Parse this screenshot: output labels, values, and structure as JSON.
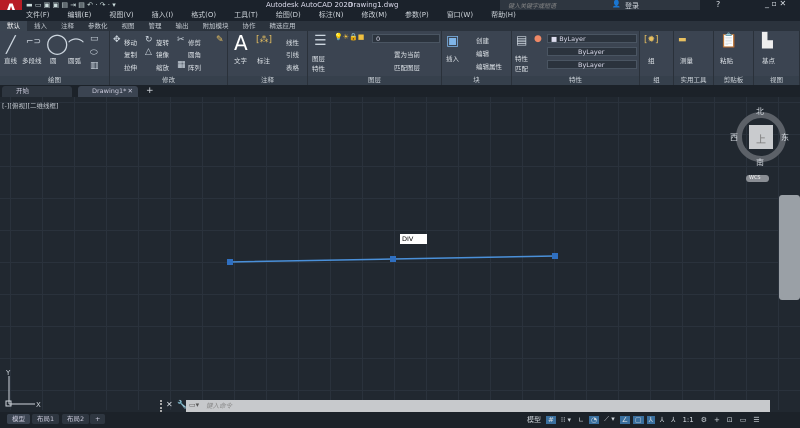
{
  "title": {
    "app": "Autodesk AutoCAD 2020",
    "file": "Drawing1.dwg",
    "search_placeholder": "键入关键字或短语",
    "login": "登录"
  },
  "menu": [
    "文件(F)",
    "编辑(E)",
    "视图(V)",
    "插入(I)",
    "格式(O)",
    "工具(T)",
    "绘图(D)",
    "标注(N)",
    "修改(M)",
    "参数(P)",
    "窗口(W)",
    "帮助(H)"
  ],
  "ribbon_tabs": [
    "默认",
    "插入",
    "注释",
    "参数化",
    "视图",
    "管理",
    "输出",
    "附加模块",
    "协作",
    "精选应用"
  ],
  "panels": {
    "draw": {
      "title": "绘图",
      "items": [
        "直线",
        "多段线",
        "圆",
        "圆弧"
      ]
    },
    "modify": {
      "title": "修改",
      "items": [
        "移动",
        "旋转",
        "修剪",
        "复制",
        "镜像",
        "圆角",
        "拉伸",
        "缩放",
        "阵列"
      ]
    },
    "annotation": {
      "title": "注释",
      "items": [
        "文字",
        "标注",
        "线性",
        "引线",
        "表格"
      ]
    },
    "layers": {
      "title": "图层",
      "items": [
        "图层特性",
        "置为当前",
        "匹配图层"
      ],
      "current_layer": "0"
    },
    "block": {
      "title": "块",
      "items": [
        "插入",
        "创建",
        "编辑",
        "编辑属性"
      ]
    },
    "properties": {
      "title": "特性",
      "match": "特性匹配",
      "color": "ByLayer",
      "linetype": "ByLayer",
      "lineweight": "ByLayer"
    },
    "group": {
      "title": "组",
      "items": [
        "组"
      ]
    },
    "utilities": {
      "title": "实用工具",
      "items": [
        "测量"
      ]
    },
    "clipboard": {
      "title": "剪贴板",
      "items": [
        "粘贴"
      ]
    },
    "view": {
      "title": "视图",
      "items": [
        "基点"
      ]
    }
  },
  "file_tabs": [
    "开始",
    "Drawing1*"
  ],
  "viewport_label": "[-][俯视][二维线框]",
  "viewcube": {
    "north": "北",
    "south": "南",
    "east": "东",
    "west": "西",
    "face": "上",
    "wcs": "WCS"
  },
  "tooltip": "DIV",
  "command_placeholder": "键入命令",
  "layout_tabs": [
    "模型",
    "布局1",
    "布局2"
  ],
  "status": {
    "model": "模型",
    "scale": "1:1"
  },
  "colors": {
    "line": "#4a90d9",
    "grips": "#2f6fc0"
  }
}
